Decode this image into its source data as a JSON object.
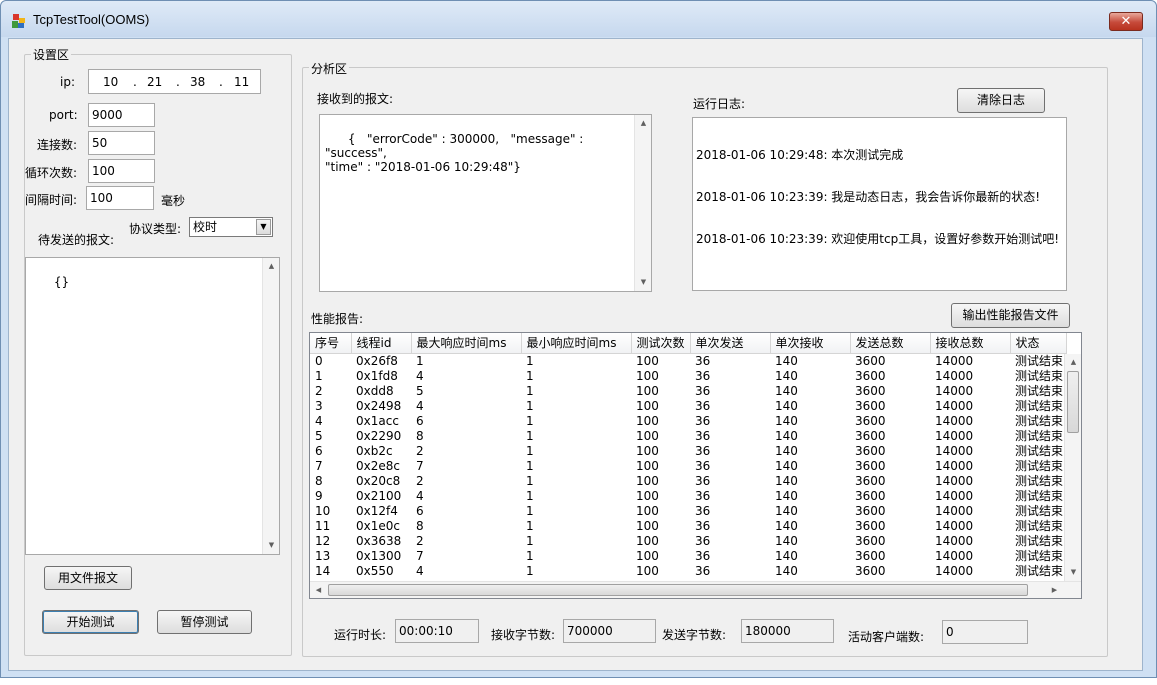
{
  "window": {
    "title": "TcpTestTool(OOMS)",
    "close_glyph": "✕"
  },
  "settings": {
    "group_title": "设置区",
    "ip_label": "ip:",
    "ip_octets": [
      "10",
      "21",
      "38",
      "11"
    ],
    "ip_separator": ".",
    "port_label": "port:",
    "port_value": "9000",
    "connections_label": "连接数:",
    "connections_value": "50",
    "loops_label": "循环次数:",
    "loops_value": "100",
    "interval_label": "间隔时间:",
    "interval_value": "100",
    "interval_unit": "毫秒",
    "pending_label": "待发送的报文:",
    "protocol_label": "协议类型:",
    "protocol_value": "校时",
    "message_text": "{}",
    "file_button": "用文件报文",
    "start_button": "开始测试",
    "pause_button": "暂停测试"
  },
  "analysis": {
    "group_title": "分析区",
    "received_label": "接收到的报文:",
    "received_text": "{   \"errorCode\" : 300000,   \"message\" : \"success\",\n\"time\" : \"2018-01-06 10:29:48\"}",
    "log_label": "运行日志:",
    "clear_log_button": "清除日志",
    "log_lines": [
      "2018-01-06 10:29:48:  本次测试完成",
      "2018-01-06 10:23:39:  我是动态日志，我会告诉你最新的状态!",
      "2018-01-06 10:23:39:  欢迎使用tcp工具，设置好参数开始测试吧!"
    ],
    "report_label": "性能报告:",
    "export_button": "输出性能报告文件",
    "table": {
      "columns": [
        "序号",
        "线程id",
        "最大响应时间ms",
        "最小响应时间ms",
        "测试次数",
        "单次发送",
        "单次接收",
        "发送总数",
        "接收总数",
        "状态"
      ],
      "rows": [
        [
          "0",
          "0x26f8",
          "1",
          "1",
          "100",
          "36",
          "140",
          "3600",
          "14000",
          "测试结束"
        ],
        [
          "1",
          "0x1fd8",
          "4",
          "1",
          "100",
          "36",
          "140",
          "3600",
          "14000",
          "测试结束"
        ],
        [
          "2",
          "0xdd8",
          "5",
          "1",
          "100",
          "36",
          "140",
          "3600",
          "14000",
          "测试结束"
        ],
        [
          "3",
          "0x2498",
          "4",
          "1",
          "100",
          "36",
          "140",
          "3600",
          "14000",
          "测试结束"
        ],
        [
          "4",
          "0x1acc",
          "6",
          "1",
          "100",
          "36",
          "140",
          "3600",
          "14000",
          "测试结束"
        ],
        [
          "5",
          "0x2290",
          "8",
          "1",
          "100",
          "36",
          "140",
          "3600",
          "14000",
          "测试结束"
        ],
        [
          "6",
          "0xb2c",
          "2",
          "1",
          "100",
          "36",
          "140",
          "3600",
          "14000",
          "测试结束"
        ],
        [
          "7",
          "0x2e8c",
          "7",
          "1",
          "100",
          "36",
          "140",
          "3600",
          "14000",
          "测试结束"
        ],
        [
          "8",
          "0x20c8",
          "2",
          "1",
          "100",
          "36",
          "140",
          "3600",
          "14000",
          "测试结束"
        ],
        [
          "9",
          "0x2100",
          "4",
          "1",
          "100",
          "36",
          "140",
          "3600",
          "14000",
          "测试结束"
        ],
        [
          "10",
          "0x12f4",
          "6",
          "1",
          "100",
          "36",
          "140",
          "3600",
          "14000",
          "测试结束"
        ],
        [
          "11",
          "0x1e0c",
          "8",
          "1",
          "100",
          "36",
          "140",
          "3600",
          "14000",
          "测试结束"
        ],
        [
          "12",
          "0x3638",
          "2",
          "1",
          "100",
          "36",
          "140",
          "3600",
          "14000",
          "测试结束"
        ],
        [
          "13",
          "0x1300",
          "7",
          "1",
          "100",
          "36",
          "140",
          "3600",
          "14000",
          "测试结束"
        ],
        [
          "14",
          "0x550",
          "4",
          "1",
          "100",
          "36",
          "140",
          "3600",
          "14000",
          "测试结束"
        ]
      ]
    },
    "status": {
      "runtime_label": "运行时长:",
      "runtime_value": "00:00:10",
      "recv_bytes_label": "接收字节数:",
      "recv_bytes_value": "700000",
      "send_bytes_label": "发送字节数:",
      "send_bytes_value": "180000",
      "clients_label": "活动客户端数:",
      "clients_value": "0"
    }
  },
  "icons": {
    "app": "app-blocks-icon",
    "close": "close-icon",
    "scroll_up": "scroll-up-arrow-icon",
    "scroll_down": "scroll-down-arrow-icon",
    "scroll_left": "scroll-left-arrow-icon",
    "scroll_right": "scroll-right-arrow-icon",
    "dropdown": "dropdown-arrow-icon"
  },
  "colors": {
    "title_bar": "#c6d8ee",
    "client_bg": "#f0f0f0",
    "close_button": "#c64a3a"
  }
}
